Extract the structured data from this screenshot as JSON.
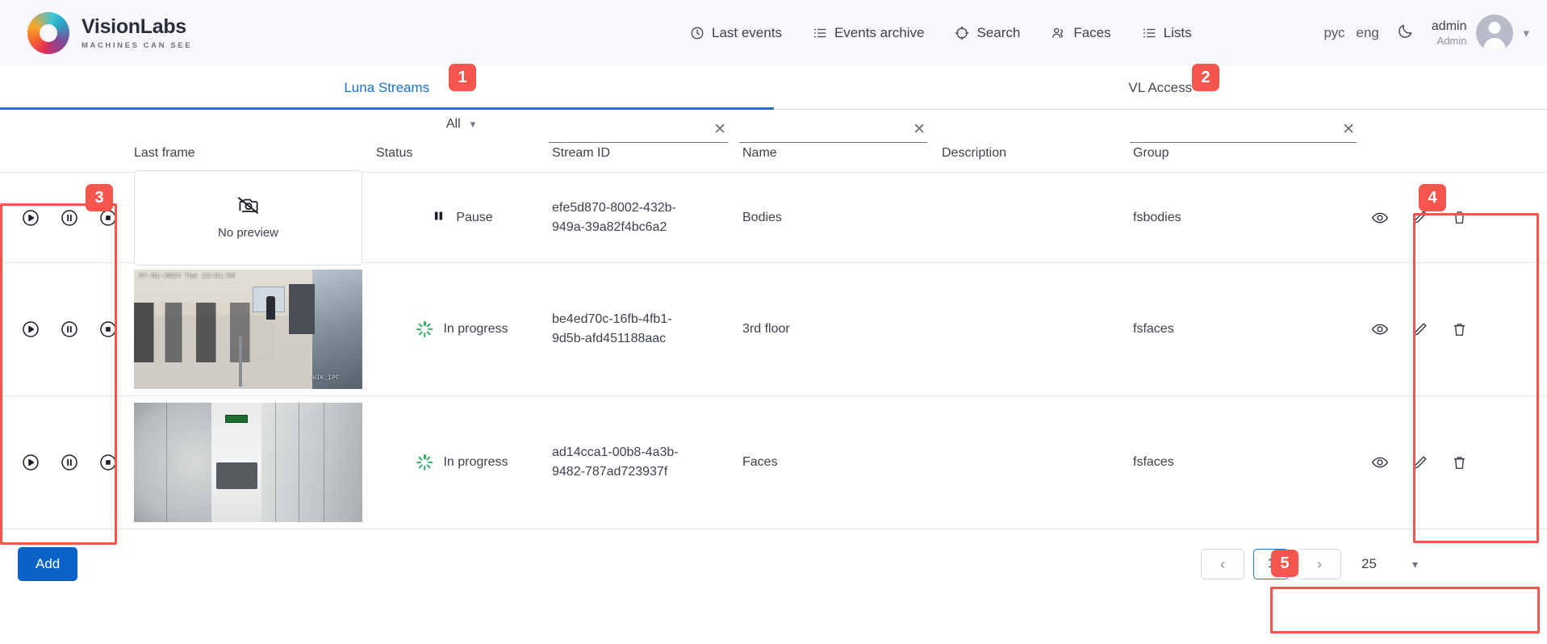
{
  "header": {
    "brand_name": "VisionLabs",
    "brand_tagline": "MACHINES CAN SEE",
    "nav": [
      {
        "label": "Last events",
        "icon": "clock-icon"
      },
      {
        "label": "Events archive",
        "icon": "list-icon"
      },
      {
        "label": "Search",
        "icon": "target-icon"
      },
      {
        "label": "Faces",
        "icon": "people-icon"
      },
      {
        "label": "Lists",
        "icon": "list-icon"
      }
    ],
    "lang": {
      "ru": "рус",
      "en": "eng"
    },
    "theme_toggle_icon": "moon-icon",
    "user": {
      "login": "admin",
      "role": "Admin"
    }
  },
  "tabs": [
    {
      "label": "Luna Streams",
      "active": true
    },
    {
      "label": "VL Access",
      "active": false
    }
  ],
  "table": {
    "columns": {
      "control": "",
      "last_frame": "Last frame",
      "status": "Status",
      "stream_id": "Stream ID",
      "name": "Name",
      "description": "Description",
      "group": "Group",
      "actions": ""
    },
    "status_filter_value": "All",
    "filters": {
      "stream_id": "",
      "name": "",
      "group": ""
    },
    "clear_label": "✕",
    "no_preview_label": "No preview",
    "rows": [
      {
        "preview": "none",
        "status": "Pause",
        "status_icon": "pause-icon",
        "stream_id_line1": "efe5d870-8002-432b-",
        "stream_id_line2": "949a-39a82f4bc6a2",
        "name": "Bodies",
        "description": "",
        "group": "fsbodies"
      },
      {
        "preview": "office-camera",
        "status": "In progress",
        "status_icon": "spinner-icon",
        "stream_id_line1": "be4ed70c-16fb-4fb1-",
        "stream_id_line2": "9d5b-afd451188aac",
        "name": "3rd floor",
        "description": "",
        "group": "fsfaces",
        "timestamp_overlay": "07-01-2024 Tue 13:51:50",
        "watermark_overlay": "HIK_IPC"
      },
      {
        "preview": "corridor-camera",
        "status": "In progress",
        "status_icon": "spinner-icon",
        "stream_id_line1": "ad14cca1-00b8-4a3b-",
        "stream_id_line2": "9482-787ad723937f",
        "name": "Faces",
        "description": "",
        "group": "fsfaces"
      }
    ],
    "row_controls": [
      {
        "name": "play",
        "icon": "play-circle-icon"
      },
      {
        "name": "pause",
        "icon": "pause-circle-icon"
      },
      {
        "name": "stop",
        "icon": "stop-circle-icon"
      }
    ],
    "row_actions": [
      {
        "name": "view",
        "icon": "eye-icon"
      },
      {
        "name": "edit",
        "icon": "pencil-icon"
      },
      {
        "name": "delete",
        "icon": "trash-icon"
      }
    ]
  },
  "footer": {
    "add_label": "Add",
    "prev_label": "‹",
    "page_number": "1",
    "next_label": "›",
    "page_size": "25"
  },
  "annotations": [
    {
      "num": "1"
    },
    {
      "num": "2"
    },
    {
      "num": "3"
    },
    {
      "num": "4"
    },
    {
      "num": "5"
    }
  ],
  "colors": {
    "accent": "#1a73d1",
    "add_button": "#0a63c9",
    "annotation": "#f4564e",
    "header_bg": "#f8f7fc",
    "status_progress": "#2faf62"
  }
}
